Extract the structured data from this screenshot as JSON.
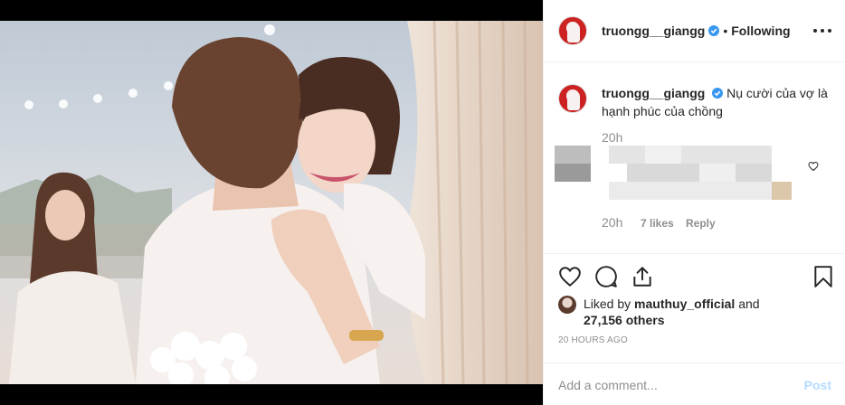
{
  "post": {
    "author": "truongg__giangg",
    "follow_status": "Following",
    "separator": "•",
    "caption": "Nụ cười của vợ là hạnh phúc của chồng",
    "caption_time": "20h"
  },
  "comment": {
    "time": "20h",
    "likes": "7 likes",
    "reply": "Reply"
  },
  "likes": {
    "prefix": "Liked by",
    "user": "mauthuy_official",
    "and": "and",
    "others": "27,156 others"
  },
  "timestamp": "20 HOURS AGO",
  "add_comment": {
    "placeholder": "Add a comment...",
    "post_label": "Post"
  },
  "icons": {
    "verified": "verified-badge-icon",
    "more": "more-options-icon",
    "like": "heart-icon",
    "comment": "comment-bubble-icon",
    "share": "share-icon",
    "save": "bookmark-icon"
  },
  "colors": {
    "verified_blue": "#3897f0",
    "muted": "#8e8e8e",
    "post_disabled": "#b3dbff"
  }
}
